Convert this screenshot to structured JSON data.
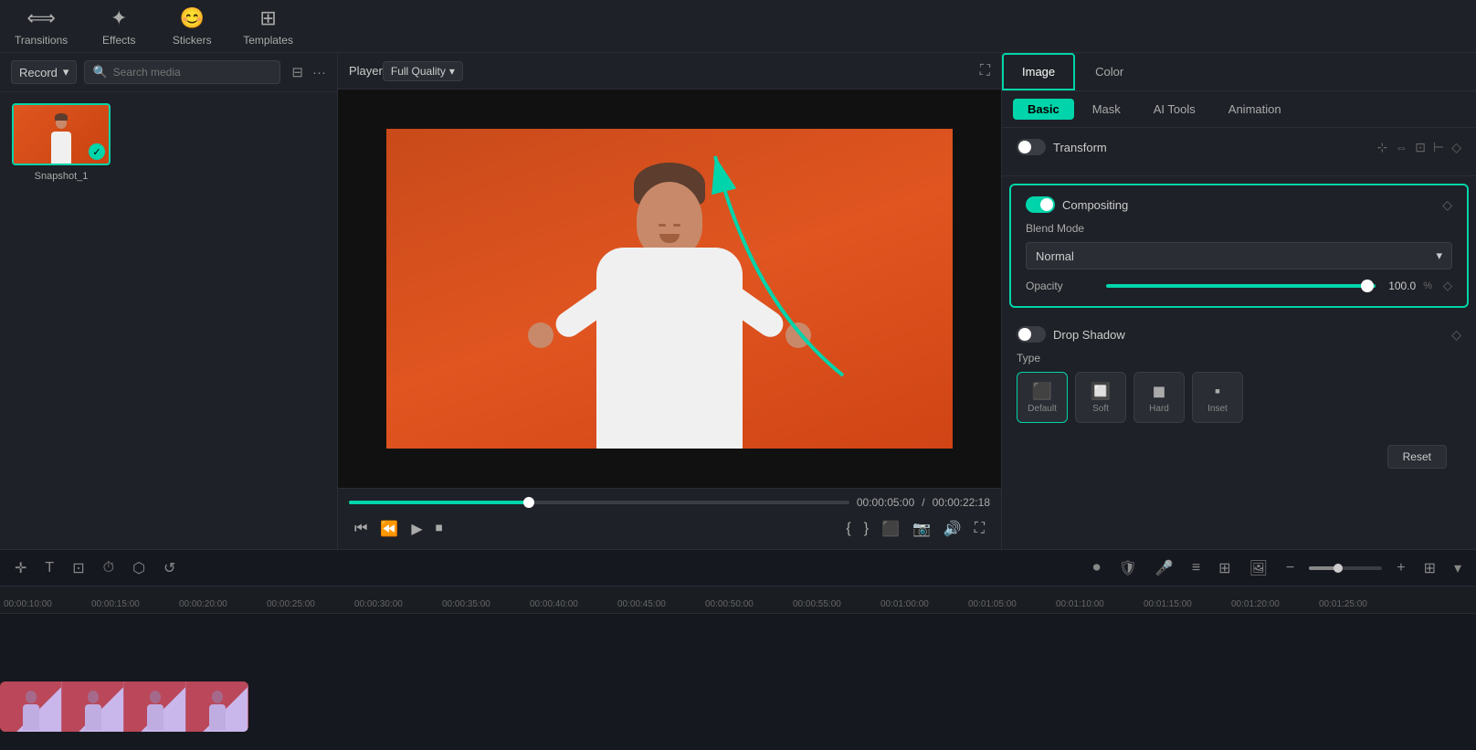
{
  "toolbar": {
    "transitions_label": "Transitions",
    "effects_label": "Effects",
    "stickers_label": "Stickers",
    "templates_label": "Templates"
  },
  "left_panel": {
    "record_label": "Record",
    "search_placeholder": "Search media",
    "media_items": [
      {
        "id": 1,
        "name": "Snapshot_1",
        "selected": true
      }
    ]
  },
  "player": {
    "label": "Player",
    "quality_label": "Full Quality",
    "current_time": "00:00:05:00",
    "total_time": "00:00:22:18"
  },
  "right_panel": {
    "tabs": [
      "Image",
      "Color"
    ],
    "active_tab": "Image",
    "subtabs": [
      "Basic",
      "Mask",
      "AI Tools",
      "Animation"
    ],
    "active_subtab": "Basic",
    "transform": {
      "title": "Transform",
      "enabled": false
    },
    "compositing": {
      "title": "Compositing",
      "enabled": true,
      "blend_mode_label": "Blend Mode",
      "blend_mode_value": "Normal",
      "opacity_label": "Opacity",
      "opacity_value": "100.0",
      "opacity_unit": "%"
    },
    "drop_shadow": {
      "title": "Drop Shadow",
      "enabled": false,
      "type_label": "Type",
      "types": [
        {
          "name": "Default",
          "icon": "⬛"
        },
        {
          "name": "Soft",
          "icon": "🔲"
        },
        {
          "name": "Hard",
          "icon": "◼"
        },
        {
          "name": "Inset",
          "icon": "▪"
        }
      ]
    },
    "reset_label": "Reset"
  },
  "timeline": {
    "ruler_marks": [
      "00:00:10:00",
      "00:00:15:00",
      "00:00:20:00",
      "00:00:25:00",
      "00:00:30:00",
      "00:00:35:00",
      "00:00:40:00",
      "00:00:45:00",
      "00:00:50:00",
      "00:00:55:00",
      "00:01:00:00",
      "00:01:05:00",
      "00:01:10:00",
      "00:01:15:00",
      "00:01:20:00",
      "00:01:25:00"
    ]
  }
}
